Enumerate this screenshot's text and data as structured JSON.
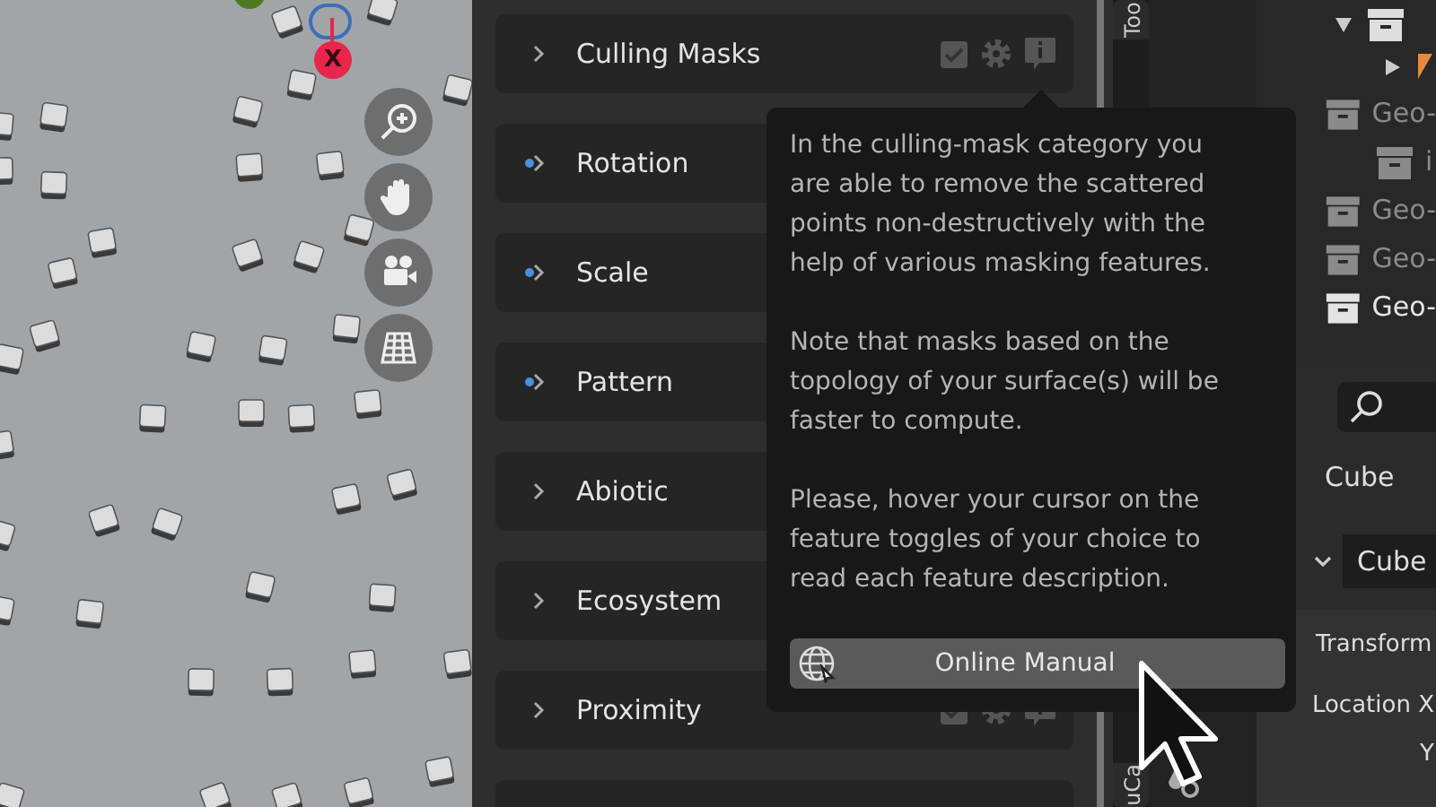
{
  "viewport": {
    "gizmo_axis": "X"
  },
  "sections": [
    {
      "label": "Culling Masks",
      "modified": false
    },
    {
      "label": "Rotation",
      "modified": true
    },
    {
      "label": "Scale",
      "modified": true
    },
    {
      "label": "Pattern",
      "modified": true
    },
    {
      "label": "Abiotic",
      "modified": false
    },
    {
      "label": "Ecosystem",
      "modified": false
    },
    {
      "label": "Proximity",
      "modified": false
    }
  ],
  "tooltip": {
    "paragraphs": [
      "In the culling-mask category you are able to remove the scattered points non-destructively with the help of various masking features.",
      "Note that masks based on the topology of your surface(s) will be faster to compute.",
      "Please, hover your cursor on the feature toggles of your choice to read each feature description."
    ],
    "button": "Online Manual"
  },
  "side_tabs": [
    "Too",
    "uCa"
  ],
  "outliner": [
    {
      "label": "Geo-",
      "dimmed": true,
      "children": [
        {
          "label": "i",
          "dimmed": true
        }
      ]
    },
    {
      "label": "Geo-",
      "dimmed": true
    },
    {
      "label": "Geo-",
      "dimmed": true
    },
    {
      "label": "Geo-",
      "dimmed": false
    }
  ],
  "properties": {
    "object_name": "Cube",
    "data_block": "Cube",
    "panel": "Transform",
    "fields": [
      "Location X",
      "Y"
    ]
  }
}
